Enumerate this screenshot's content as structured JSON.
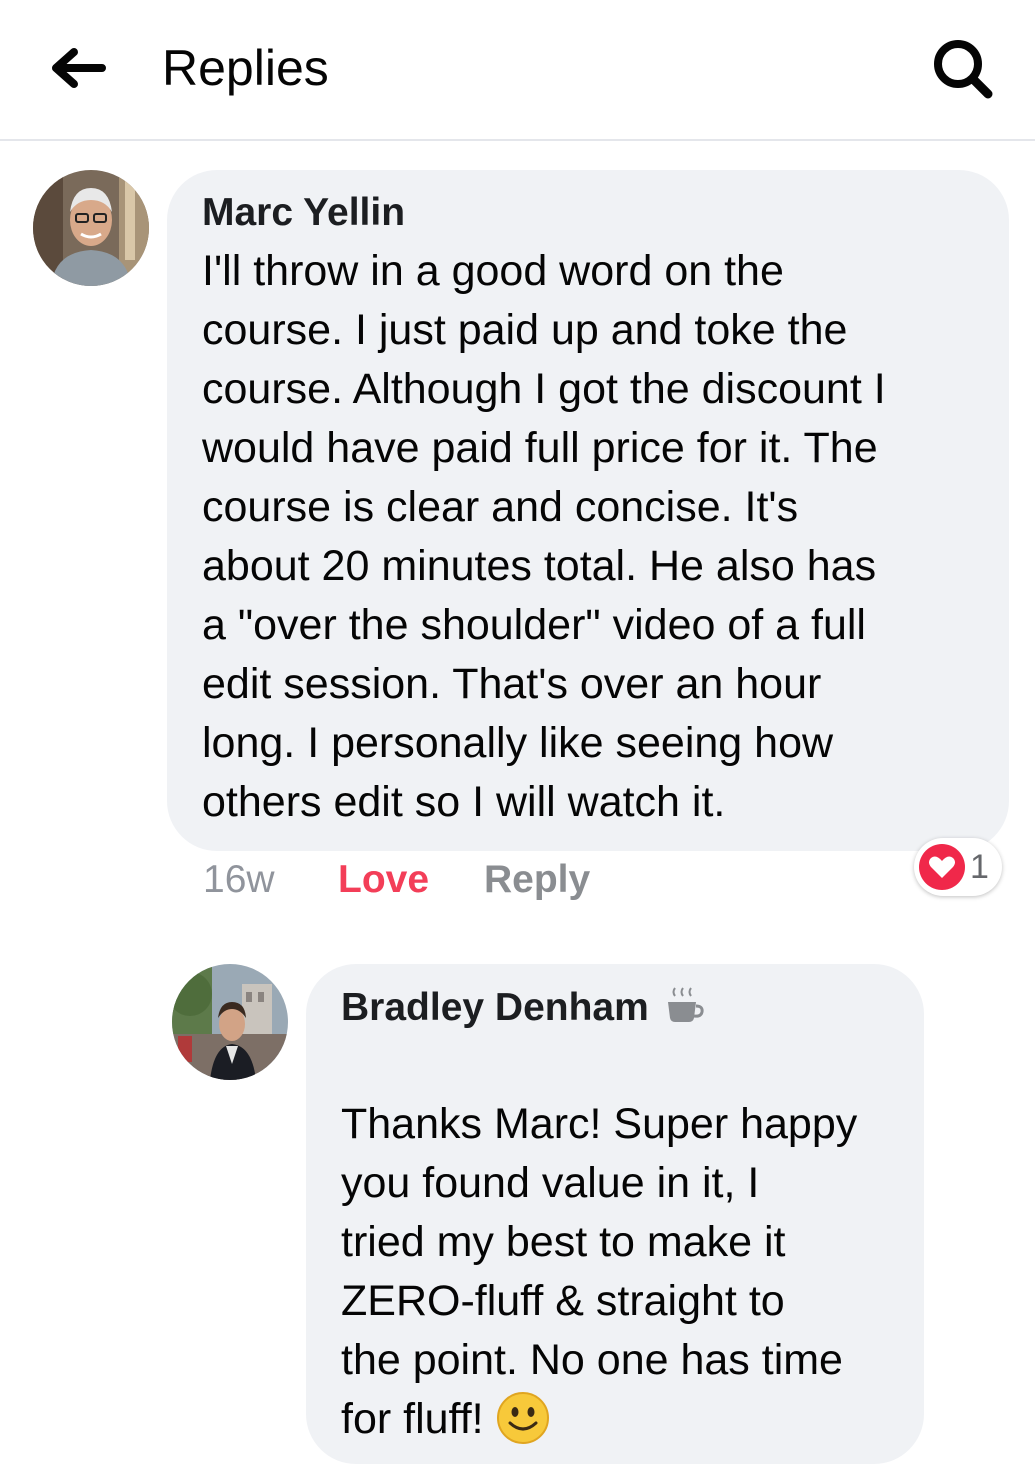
{
  "header": {
    "title": "Replies",
    "back_icon": "arrow-left-icon",
    "search_icon": "search-icon"
  },
  "comments": [
    {
      "author": "Marc Yellin",
      "text": "I'll throw in a good word on the\ncourse.  I just paid up and toke the\ncourse.   Although I got the discount I\nwould have paid full price for it.  The\ncourse is clear and concise.  It's\nabout 20 minutes total.  He also has\na \"over the shoulder\" video of a full\nedit session. That's over an hour\nlong.  I personally like seeing how\nothers edit so I will watch it.",
      "time": "16w",
      "reaction_label": "Love",
      "reply_label": "Reply",
      "reaction_count": "1",
      "reaction_icon": "heart-icon"
    },
    {
      "author": "Bradley Denham",
      "badge_icon": "coffee-cup-icon",
      "text": "Thanks Marc! Super happy\nyou found value in it, I\ntried my best to make it\nZERO-fluff & straight to\nthe point. No one has time\nfor fluff! ",
      "emoji_icon": "smiley-emoji-icon"
    }
  ],
  "colors": {
    "bubble": "#f0f2f5",
    "love": "#f33e58",
    "muted": "#8a8d91"
  }
}
